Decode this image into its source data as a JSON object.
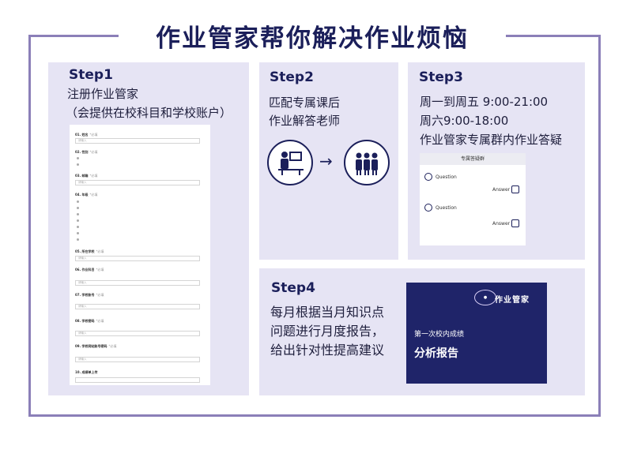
{
  "title": "作业管家帮你解决作业烦恼",
  "step1": {
    "label": "Step1",
    "line1": "注册作业管家",
    "line2": "（会提供在校科目和学校账户）",
    "form": {
      "q1": "01. 姓名",
      "q2": "02. 性别",
      "q3": "03. 邮箱",
      "q4": "04. 年级",
      "q5": "05. 所在学校",
      "q6": "06. 作业科目",
      "q7": "07. 学校账号",
      "q8": "08. 学校密码",
      "q9": "09. 学校网站账号密码",
      "q10": "10. 成绩单上传",
      "tag": "*必填",
      "placeholder": "请输入"
    }
  },
  "step2": {
    "label": "Step2",
    "line1": "匹配专属课后",
    "line2": "作业解答老师"
  },
  "step3": {
    "label": "Step3",
    "line1": "周一到周五 9:00-21:00",
    "line2": "周六9:00-18:00",
    "line3": "作业管家专属群内作业答疑",
    "qa": {
      "header": "专属答疑群",
      "question": "Question",
      "answer": "Answer"
    }
  },
  "step4": {
    "label": "Step4",
    "line1": "每月根据当月知识点",
    "line2": "问题进行月度报告，",
    "line3": "给出针对性提高建议",
    "report": {
      "brand": "作业管家",
      "sub": "第一次校内成绩",
      "main": "分析报告"
    }
  }
}
